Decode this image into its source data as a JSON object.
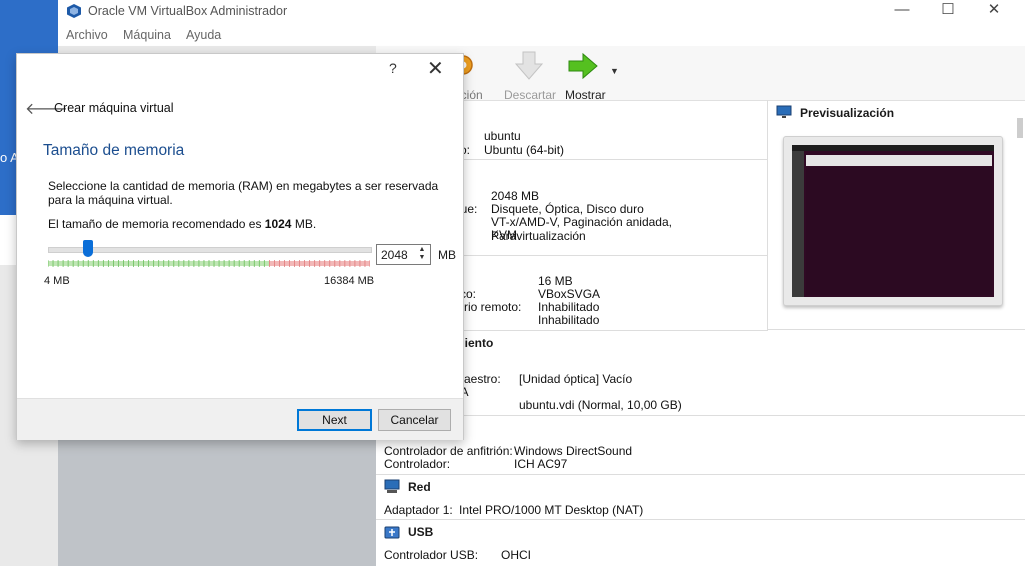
{
  "desktop": {
    "edge_text": "o A"
  },
  "window": {
    "title": "Oracle VM VirtualBox Administrador",
    "controls": [
      "—",
      "☐",
      "✕"
    ]
  },
  "menu": [
    "Archivo",
    "Máquina",
    "Ayuda"
  ],
  "toolbar": {
    "config_label": "ración",
    "discard_label": "Descartar",
    "show_label": "Mostrar"
  },
  "general": {
    "name_value": "ubuntu",
    "os_label_partial": "vo:",
    "os_value": "Ubuntu (64-bit)"
  },
  "system": {
    "memory_value": "2048 MB",
    "boot_label_partial": "que:",
    "boot_value": "Disquete, Óptica, Disco duro",
    "accel_value": "VT-x/AMD-V, Paginación anidada, Paravirtualización",
    "accel_value2": "KVM"
  },
  "display": {
    "vram_label_partial": "o:",
    "vram_value": "16 MB",
    "ctrl_label_partial": "fico:",
    "ctrl_value": "VBoxSVGA",
    "remote_label_partial": "torio remoto:",
    "remote_value": "Inhabilitado",
    "rec_value": "Inhabilitado"
  },
  "storage": {
    "title_partial": "miento",
    "ctrl_partial": ":",
    "master_label_partial": "maestro:",
    "master_value": "[Unidad óptica] Vacío",
    "sata_partial": "TA",
    "disk_value": "ubuntu.vdi (Normal, 10,00 GB)"
  },
  "audio": {
    "host_label": "Controlador de anfitrión:",
    "host_value": "Windows DirectSound",
    "ctrl_label": "Controlador:",
    "ctrl_value": "ICH AC97"
  },
  "network": {
    "title": "Red",
    "adapter_label": "Adaptador 1:",
    "adapter_value": "Intel PRO/1000 MT Desktop (NAT)"
  },
  "usb": {
    "title": "USB",
    "ctrl_label": "Controlador USB:",
    "ctrl_value": "OHCI"
  },
  "preview": {
    "title": "Previsualización"
  },
  "dialog": {
    "help": "?",
    "close": "✕",
    "heading": "Crear máquina virtual",
    "page_title": "Tamaño de memoria",
    "description": "Seleccione la cantidad de memoria (RAM) en megabytes a ser reservada para la máquina virtual.",
    "recommended_prefix": "El tamaño de memoria recomendado es ",
    "recommended_value": "1024",
    "recommended_suffix": " MB.",
    "memory_value": "2048",
    "memory_unit": "MB",
    "min_label": "4 MB",
    "max_label": "16384 MB",
    "slider_min_mb": 4,
    "slider_max_mb": 16384,
    "slider_value_mb": 2048,
    "next_label": "Next",
    "cancel_label": "Cancelar"
  }
}
